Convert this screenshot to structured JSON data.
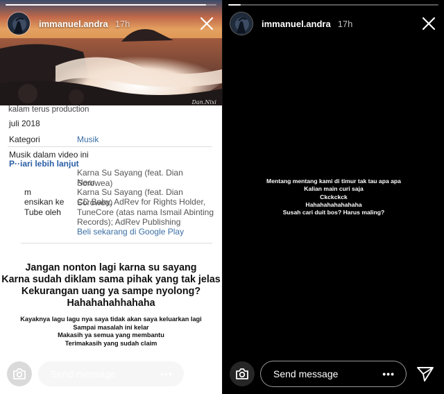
{
  "left_story": {
    "progress": 0.95,
    "username": "immanuel.andra",
    "time": "17h",
    "photo_signature": "Dan.Nixi",
    "youtube": {
      "cut_line": "kalam terus production",
      "date": "juli 2018",
      "kategori_label": "Kategori",
      "kategori_value": "Musik",
      "musik_label": "Musik dalam video ini",
      "learn_more": "P··iari lebih lanjut",
      "rows": [
        {
          "label": "",
          "value": "Karna Su Sayang (feat. Dian Sorowea)"
        },
        {
          "label": "",
          "value": "Near"
        },
        {
          "label": "m",
          "value": "Karna Su Sayang (feat. Dian Sorowea)"
        },
        {
          "label": "ensikan ke",
          "value": "CD Baby, AdRev for Rights Holder,"
        },
        {
          "label": "Tube oleh",
          "value": "TuneCore (atas nama Ismail Abinting"
        },
        {
          "label": "",
          "value": "Records); AdRev Publishing"
        }
      ],
      "buy_link": "Beli sekarang di Google Play"
    },
    "caption_big": [
      "Jangan nonton lagi karna su sayang",
      "Karna sudah diklam sama pihak yang tak jelas",
      "Kekurangan uang ya sampe nyolong?",
      "Hahahahahhahaha"
    ],
    "caption_small": [
      "Kayaknya lagu lagu nya saya tidak akan saya keluarkan lagi",
      "Sampai masalah ini kelar",
      "Makasih ya semua yang membantu",
      "Terimakasih yang sudah claim"
    ],
    "send_placeholder": "Send message",
    "more": "•••"
  },
  "right_story": {
    "progress": 0.06,
    "username": "immanuel.andra",
    "time": "17h",
    "lines": [
      "Mentang mentang kami di timur tak tau apa apa",
      "Kalian main curi saja",
      "Ckckckck",
      "Hahahahahahahaha",
      "Susah cari duit bos? Harus maling?"
    ],
    "send_placeholder": "Send message",
    "more": "•••"
  },
  "icons": {
    "camera": "camera-icon",
    "close": "close-icon",
    "direct": "paper-plane-icon",
    "more": "more-dots-icon"
  },
  "colors": {
    "link": "#3a6ea5",
    "text_white": "#ffffff",
    "background_dark": "#000000"
  }
}
